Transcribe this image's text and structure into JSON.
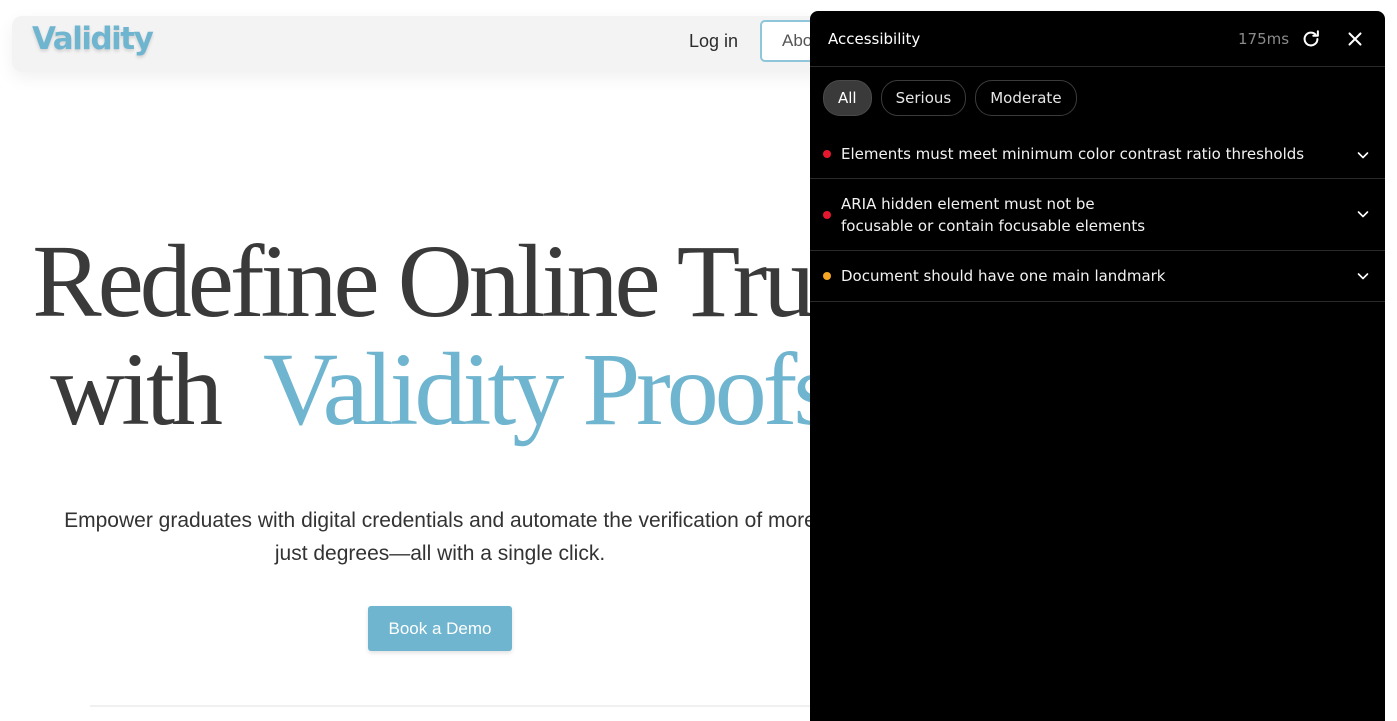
{
  "site": {
    "logo": "Validity",
    "nav": {
      "login": "Log in",
      "about": "Abo"
    },
    "hero": {
      "line1": "Redefine Online Trus",
      "line2_plain": "with",
      "line2_accent": "Validity Proofs",
      "subtitle_line1": "Empower graduates with digital credentials and automate the verification of more",
      "subtitle_line2": "just degrees—all with a single click.",
      "cta": "Book a Demo"
    },
    "accent_color": "#6fb5cf"
  },
  "panel": {
    "title": "Accessibility",
    "timing": "175ms",
    "icons": {
      "refresh": "refresh-icon",
      "close": "close-icon",
      "expand": "chevron-down-icon"
    },
    "filters": [
      {
        "label": "All",
        "active": true
      },
      {
        "label": "Serious",
        "active": false
      },
      {
        "label": "Moderate",
        "active": false
      }
    ],
    "issues": [
      {
        "text": "Elements must meet minimum color contrast ratio thresholds",
        "severity": "serious",
        "color": "#e5172f"
      },
      {
        "text": "ARIA hidden element must not be\nfocusable or contain focusable elements",
        "severity": "serious",
        "color": "#e5172f"
      },
      {
        "text": "Document should have one main landmark",
        "severity": "moderate",
        "color": "#f5a623"
      }
    ]
  }
}
